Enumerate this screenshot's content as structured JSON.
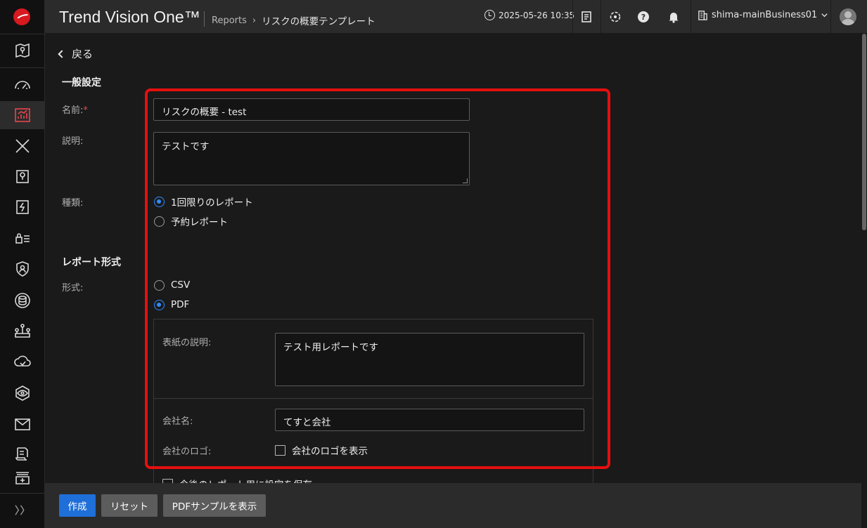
{
  "header": {
    "brand": "Trend Vision One™",
    "breadcrumb": [
      "Reports",
      "›",
      "リスクの概要テンプレート"
    ],
    "datetime": "2025-05-26 10:35",
    "account": "shima-mainBusiness01"
  },
  "nav": {
    "expand_label": "〉〉"
  },
  "page": {
    "back_label": "戻る",
    "general_section": "一般設定",
    "name_label": "名前:",
    "name_required": "*",
    "name_value": "リスクの概要 - test",
    "description_label": "説明:",
    "description_value": "テストです",
    "type_label": "種類:",
    "type_options": [
      "1回限りのレポート",
      "予約レポート"
    ],
    "type_selected": "1回限りのレポート",
    "format_section": "レポート形式",
    "format_label": "形式:",
    "format_options": [
      "CSV",
      "PDF"
    ],
    "format_selected": "PDF",
    "cover_label": "表紙の説明:",
    "cover_value": "テスト用レポートです",
    "company_label": "会社名:",
    "company_value": "てすと会社",
    "logo_label": "会社のロゴ:",
    "logo_checkbox_label": "会社のロゴを表示",
    "logo_checked": false,
    "save_settings_label": "今後のレポート用に設定を保存",
    "save_settings_checked": false
  },
  "footer": {
    "create": "作成",
    "reset": "リセット",
    "preview_pdf": "PDFサンプルを表示"
  },
  "colors": {
    "accent": "#1f6fd8",
    "highlight": "#e50f0f",
    "active_nav": "#e8464d"
  }
}
